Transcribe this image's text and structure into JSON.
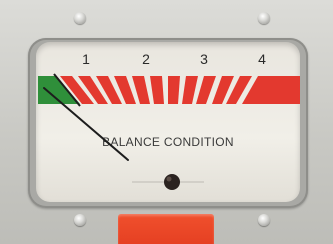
{
  "meter": {
    "scale_labels": [
      "1",
      "2",
      "3",
      "4"
    ],
    "title": "BALANCE CONDITION"
  },
  "colors": {
    "scale_red": "#e3392f",
    "scale_green": "#2f8f3a",
    "needle": "#1d1d1d"
  }
}
